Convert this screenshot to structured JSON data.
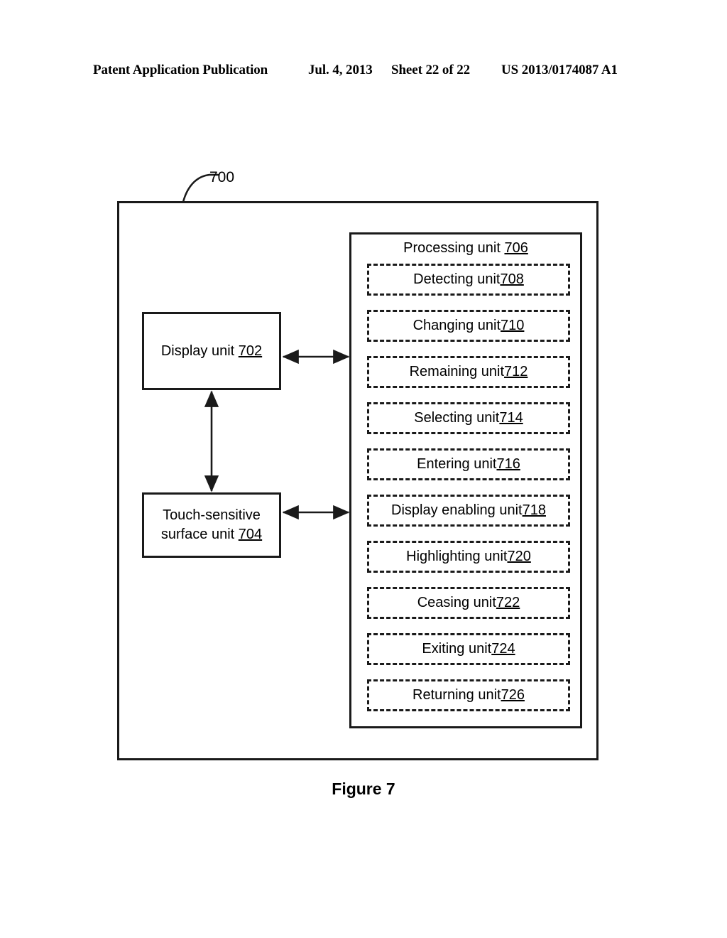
{
  "header": {
    "publication": "Patent Application Publication",
    "date": "Jul. 4, 2013",
    "sheet": "Sheet 22 of 22",
    "patent_number": "US 2013/0174087 A1"
  },
  "figure": {
    "caption": "Figure 7",
    "system_reference": "700"
  },
  "left_column": {
    "display_unit": {
      "label": "Display unit ",
      "ref": "702"
    },
    "touch_surface_unit": {
      "label": "Touch-sensitive\nsurface unit ",
      "ref": "704"
    }
  },
  "processing_unit": {
    "title_label": "Processing unit ",
    "title_ref": "706",
    "sub_units": [
      {
        "label": "Detecting unit ",
        "ref": "708"
      },
      {
        "label": "Changing unit ",
        "ref": "710"
      },
      {
        "label": "Remaining unit ",
        "ref": "712"
      },
      {
        "label": "Selecting unit ",
        "ref": "714"
      },
      {
        "label": "Entering unit ",
        "ref": "716"
      },
      {
        "label": "Display enabling unit ",
        "ref": "718"
      },
      {
        "label": "Highlighting unit ",
        "ref": "720"
      },
      {
        "label": "Ceasing unit ",
        "ref": "722"
      },
      {
        "label": "Exiting unit ",
        "ref": "724"
      },
      {
        "label": "Returning unit ",
        "ref": "726"
      }
    ]
  },
  "connectors": [
    {
      "name": "display-to-processing",
      "orientation": "horizontal",
      "double_headed": true
    },
    {
      "name": "touch-to-processing",
      "orientation": "horizontal",
      "double_headed": true
    },
    {
      "name": "display-to-touch",
      "orientation": "vertical",
      "double_headed": true
    }
  ],
  "colors": {
    "ink": "#1a1a1a",
    "paper": "#ffffff"
  }
}
